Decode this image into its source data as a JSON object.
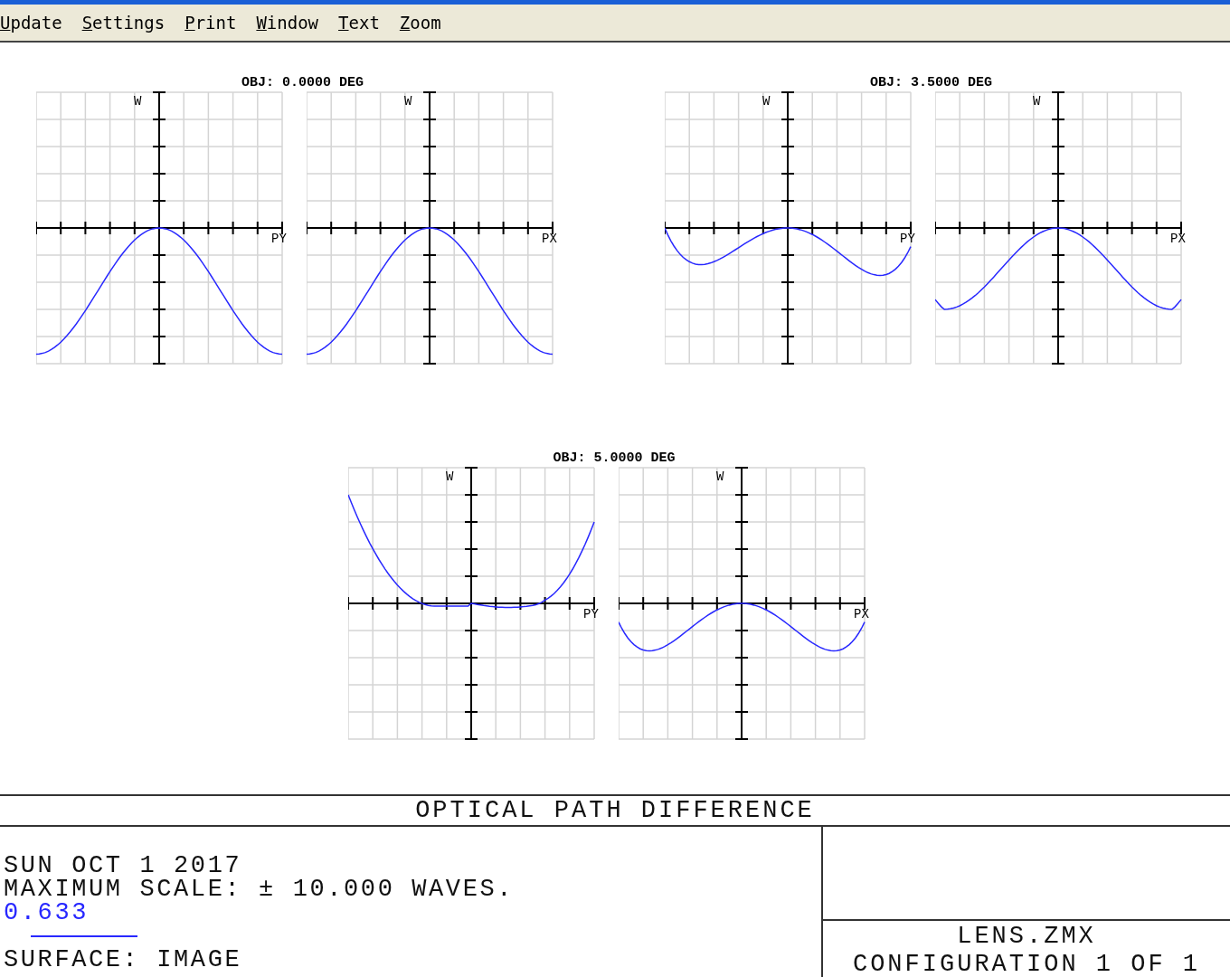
{
  "menu": [
    {
      "label": "Update"
    },
    {
      "label": "Settings"
    },
    {
      "label": "Print"
    },
    {
      "label": "Window"
    },
    {
      "label": "Text"
    },
    {
      "label": "Zoom"
    }
  ],
  "plot_groups": [
    {
      "title": "OBJ: 0.0000 DEG",
      "plots": [
        {
          "axis_label": "W",
          "fan_label": "PY"
        },
        {
          "axis_label": "W",
          "fan_label": "PX"
        }
      ]
    },
    {
      "title": "OBJ: 3.5000 DEG",
      "plots": [
        {
          "axis_label": "W",
          "fan_label": "PY"
        },
        {
          "axis_label": "W",
          "fan_label": "PX"
        }
      ]
    },
    {
      "title": "OBJ: 5.0000 DEG",
      "plots": [
        {
          "axis_label": "W",
          "fan_label": "PY"
        },
        {
          "axis_label": "W",
          "fan_label": "PX"
        }
      ]
    }
  ],
  "report": {
    "title": "OPTICAL PATH DIFFERENCE",
    "date": "SUN OCT 1 2017",
    "scale": "MAXIMUM SCALE: ± 10.000 WAVES.",
    "legend": [
      {
        "wavelength": "0.633",
        "color": "#2828ff"
      }
    ],
    "surface": "SURFACE: IMAGE",
    "file": "LENS.ZMX",
    "configuration": "CONFIGURATION 1 OF 1"
  }
}
